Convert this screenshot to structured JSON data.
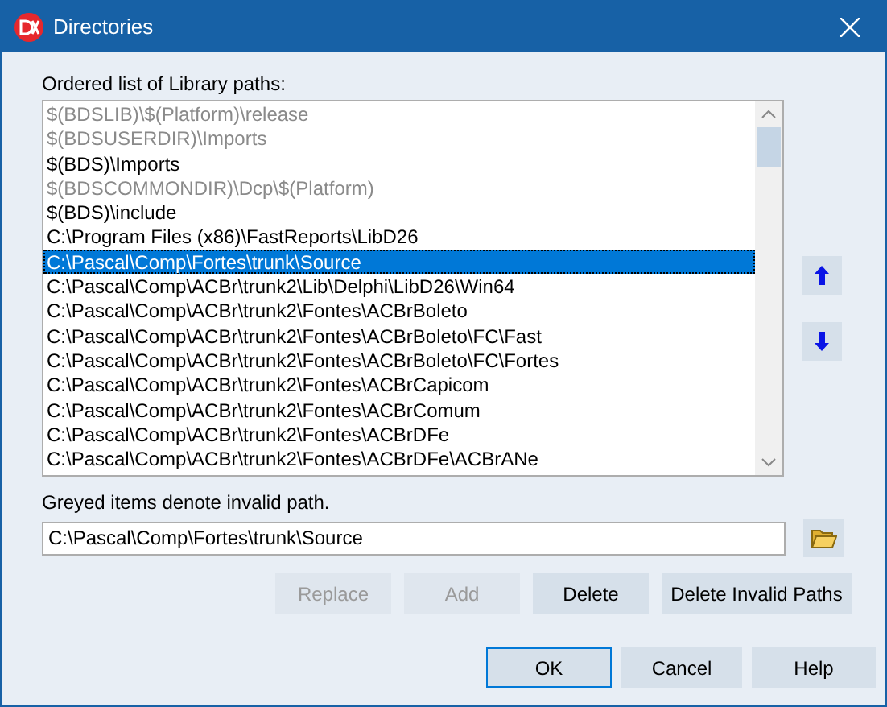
{
  "window": {
    "title": "Directories"
  },
  "list_label": "Ordered list of Library paths:",
  "paths": [
    {
      "text": "$(BDSLIB)\\$(Platform)\\release",
      "invalid": true,
      "selected": false
    },
    {
      "text": "$(BDSUSERDIR)\\Imports",
      "invalid": true,
      "selected": false
    },
    {
      "text": "$(BDS)\\Imports",
      "invalid": false,
      "selected": false
    },
    {
      "text": "$(BDSCOMMONDIR)\\Dcp\\$(Platform)",
      "invalid": true,
      "selected": false
    },
    {
      "text": "$(BDS)\\include",
      "invalid": false,
      "selected": false
    },
    {
      "text": "C:\\Program Files (x86)\\FastReports\\LibD26",
      "invalid": false,
      "selected": false
    },
    {
      "text": "C:\\Pascal\\Comp\\Fortes\\trunk\\Source",
      "invalid": false,
      "selected": true
    },
    {
      "text": "C:\\Pascal\\Comp\\ACBr\\trunk2\\Lib\\Delphi\\LibD26\\Win64",
      "invalid": false,
      "selected": false
    },
    {
      "text": "C:\\Pascal\\Comp\\ACBr\\trunk2\\Fontes\\ACBrBoleto",
      "invalid": false,
      "selected": false
    },
    {
      "text": "C:\\Pascal\\Comp\\ACBr\\trunk2\\Fontes\\ACBrBoleto\\FC\\Fast",
      "invalid": false,
      "selected": false
    },
    {
      "text": "C:\\Pascal\\Comp\\ACBr\\trunk2\\Fontes\\ACBrBoleto\\FC\\Fortes",
      "invalid": false,
      "selected": false
    },
    {
      "text": "C:\\Pascal\\Comp\\ACBr\\trunk2\\Fontes\\ACBrCapicom",
      "invalid": false,
      "selected": false
    },
    {
      "text": "C:\\Pascal\\Comp\\ACBr\\trunk2\\Fontes\\ACBrComum",
      "invalid": false,
      "selected": false
    },
    {
      "text": "C:\\Pascal\\Comp\\ACBr\\trunk2\\Fontes\\ACBrDFe",
      "invalid": false,
      "selected": false
    },
    {
      "text": "C:\\Pascal\\Comp\\ACBr\\trunk2\\Fontes\\ACBrDFe\\ACBrANe",
      "invalid": false,
      "selected": false
    }
  ],
  "hint": "Greyed items denote invalid path.",
  "path_field": {
    "value": "C:\\Pascal\\Comp\\Fortes\\trunk\\Source"
  },
  "actions": [
    {
      "label": "Replace",
      "disabled": true
    },
    {
      "label": "Add",
      "disabled": true
    },
    {
      "label": "Delete",
      "disabled": false
    },
    {
      "label": "Delete Invalid Paths",
      "disabled": false
    }
  ],
  "buttons": [
    {
      "label": "OK",
      "default": true
    },
    {
      "label": "Cancel",
      "default": false
    },
    {
      "label": "Help",
      "default": false
    }
  ]
}
